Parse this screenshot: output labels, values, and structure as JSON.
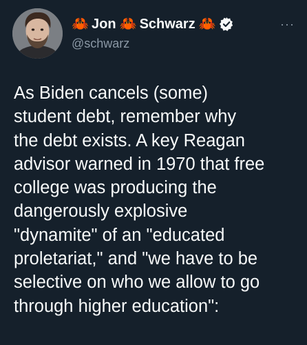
{
  "author": {
    "name_parts": [
      "Jon",
      "Schwarz"
    ],
    "crab_emoji": "🦀",
    "handle": "@schwarz",
    "verified": true
  },
  "menu": {
    "more_label": "···"
  },
  "tweet": {
    "text": "As Biden cancels (some)\nstudent debt, remember why\nthe debt exists. A key Reagan\nadvisor warned in 1970 that free\ncollege was producing the\ndangerously explosive\n\"dynamite\" of an \"educated\nproletariat,\" and \"we have to be\nselective on who we allow to go\nthrough higher education\":"
  },
  "colors": {
    "background": "#15202b",
    "text_primary": "#f7f9f9",
    "text_secondary": "#8b98a5",
    "crab": "#e0462e"
  }
}
